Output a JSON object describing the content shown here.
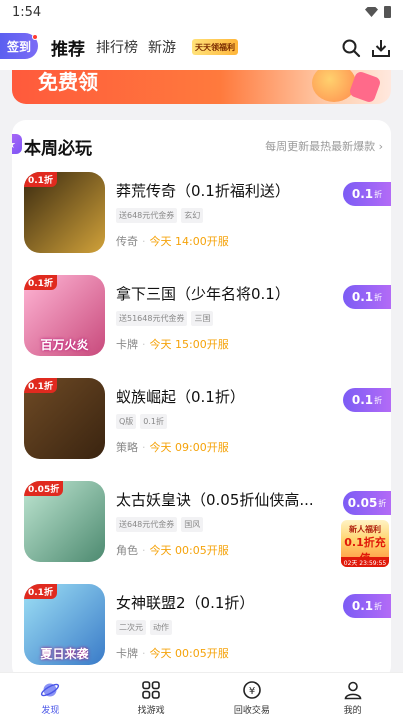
{
  "status_bar": {
    "time": "1:54"
  },
  "top_nav": {
    "signin_label": "签到",
    "tabs": [
      "推荐",
      "排行榜",
      "新游"
    ],
    "badge_label": "天天领福利"
  },
  "banner": {
    "text": "免费领"
  },
  "section": {
    "title": "本周必玩",
    "more": "每周更新最热最新爆款 ›"
  },
  "games": [
    {
      "title": "莽荒传奇（0.1折福利送）",
      "tags": [
        "送648元代金券",
        "玄幻"
      ],
      "category": "传奇",
      "open": "今天 14:00开服",
      "discount_value": "0.1",
      "discount_unit": "折",
      "thumb_tag": "0.1折",
      "thumb_label": "",
      "thumb_colors": [
        "#3a2a10",
        "#d1a23a"
      ]
    },
    {
      "title": "拿下三国（少年名将0.1）",
      "tags": [
        "送51648元代金券",
        "三国"
      ],
      "category": "卡牌",
      "open": "今天 15:00开服",
      "discount_value": "0.1",
      "discount_unit": "折",
      "thumb_tag": "0.1折",
      "thumb_label": "百万火炎",
      "thumb_colors": [
        "#ffb6d5",
        "#c84a7c"
      ]
    },
    {
      "title": "蚁族崛起（0.1折）",
      "tags": [
        "Q版",
        "0.1折"
      ],
      "category": "策略",
      "open": "今天 09:00开服",
      "discount_value": "0.1",
      "discount_unit": "折",
      "thumb_tag": "0.1折",
      "thumb_label": "",
      "thumb_colors": [
        "#6e4a25",
        "#3a2410"
      ]
    },
    {
      "title": "太古妖皇诀（0.05折仙侠高...",
      "tags": [
        "送648元代金券",
        "国风"
      ],
      "category": "角色",
      "open": "今天 00:05开服",
      "discount_value": "0.05",
      "discount_unit": "折",
      "thumb_tag": "0.05折",
      "thumb_label": "",
      "thumb_colors": [
        "#bfe6d2",
        "#4d8a70"
      ],
      "promo": {
        "line1": "新人福利",
        "line2": "0.1折充值",
        "line3": "02天 23:59:55"
      }
    },
    {
      "title": "女神联盟2（0.1折）",
      "tags": [
        "二次元",
        "动作"
      ],
      "category": "卡牌",
      "open": "今天 00:05开服",
      "discount_value": "0.1",
      "discount_unit": "折",
      "thumb_tag": "0.1折",
      "thumb_label": "夏日来袭",
      "thumb_colors": [
        "#9ee0f5",
        "#3a7bc8"
      ]
    }
  ],
  "bottom_nav": [
    {
      "label": "发现",
      "icon": "planet-icon",
      "active": true
    },
    {
      "label": "找游戏",
      "icon": "grid-icon",
      "active": false
    },
    {
      "label": "回收交易",
      "icon": "yuan-icon",
      "active": false
    },
    {
      "label": "我的",
      "icon": "person-icon",
      "active": false
    }
  ],
  "colors": {
    "accent": "#7c5cf5",
    "open_time": "#f5a30b",
    "banner": "#ff5a3c"
  }
}
